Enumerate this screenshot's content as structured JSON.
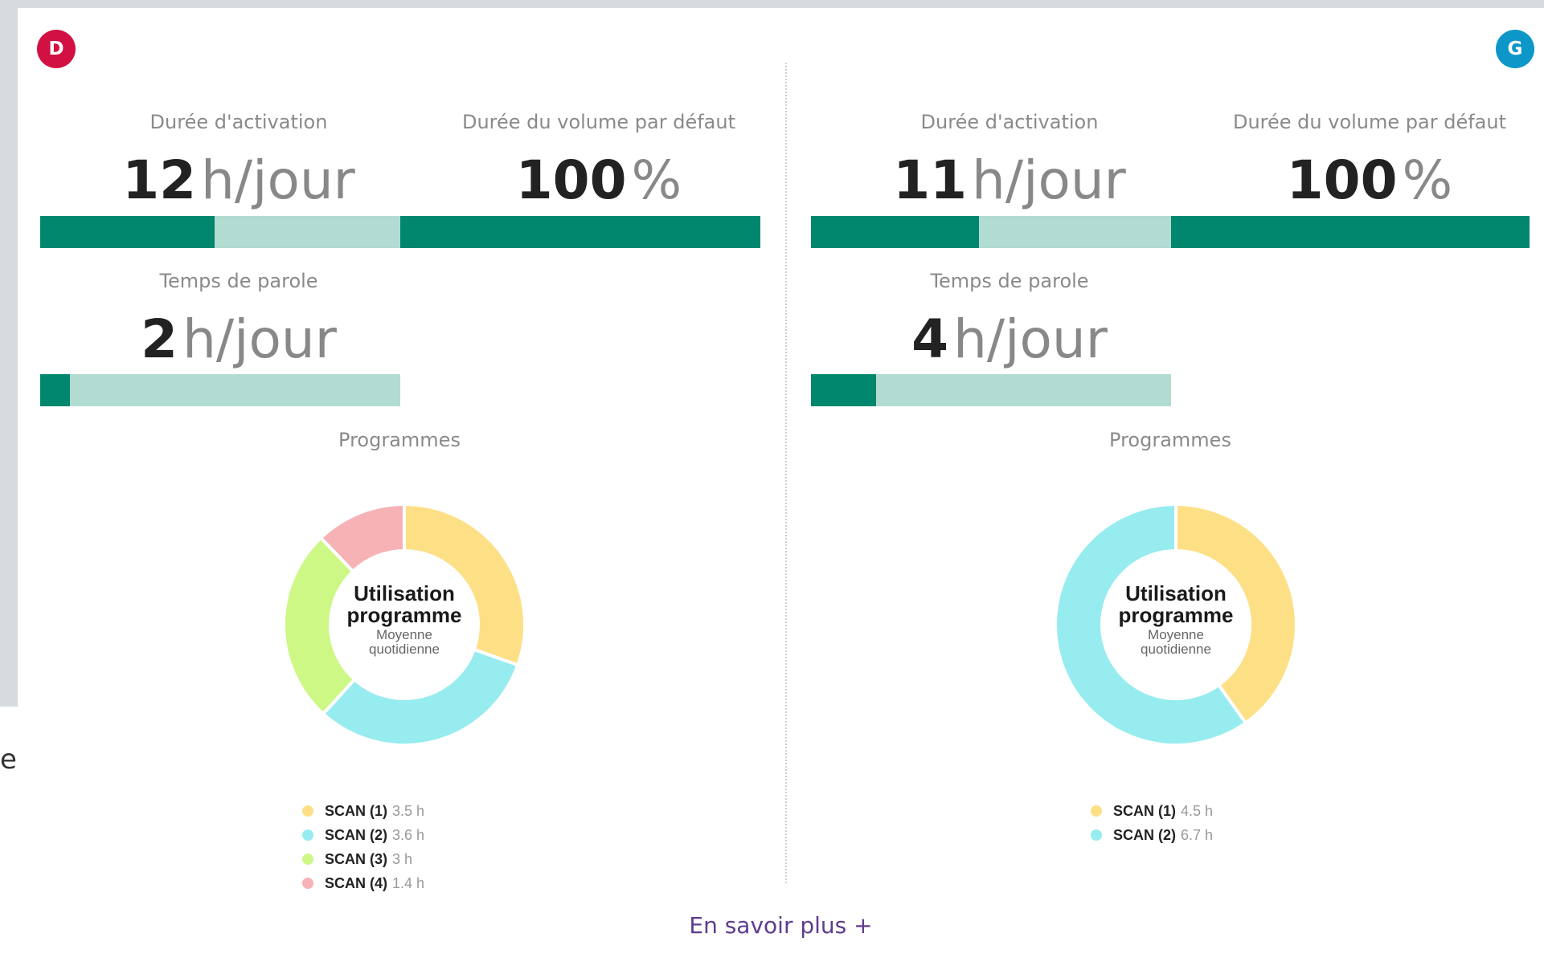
{
  "edge_text": "e",
  "more_link": "En savoir plus +",
  "panels": [
    {
      "badge": "D",
      "badge_color": "#d21042",
      "activation": {
        "label": "Durée d'activation",
        "value": "12",
        "unit": "h/jour",
        "fraction": 0.485
      },
      "volume": {
        "label": "Durée du volume par défaut",
        "value": "100",
        "unit": "%",
        "fraction": 1.0
      },
      "talk": {
        "label": "Temps de parole",
        "value": "2",
        "unit": "h/jour",
        "fraction": 0.083
      },
      "programs_label": "Programmes",
      "donut_title_1": "Utilisation",
      "donut_title_2": "programme",
      "donut_sub_1": "Moyenne",
      "donut_sub_2": "quotidienne",
      "legend": [
        {
          "name": "SCAN (1)",
          "value": "3.5 h"
        },
        {
          "name": "SCAN (2)",
          "value": "3.6 h"
        },
        {
          "name": "SCAN (3)",
          "value": "3 h"
        },
        {
          "name": "SCAN (4)",
          "value": "1.4 h"
        }
      ]
    },
    {
      "badge": "G",
      "badge_color": "#0d96c8",
      "activation": {
        "label": "Durée d'activation",
        "value": "11",
        "unit": "h/jour",
        "fraction": 0.467
      },
      "volume": {
        "label": "Durée du volume par défaut",
        "value": "100",
        "unit": "%",
        "fraction": 1.0
      },
      "talk": {
        "label": "Temps de parole",
        "value": "4",
        "unit": "h/jour",
        "fraction": 0.18
      },
      "programs_label": "Programmes",
      "donut_title_1": "Utilisation",
      "donut_title_2": "programme",
      "donut_sub_1": "Moyenne",
      "donut_sub_2": "quotidienne",
      "legend": [
        {
          "name": "SCAN (1)",
          "value": "4.5 h"
        },
        {
          "name": "SCAN (2)",
          "value": "6.7 h"
        }
      ]
    }
  ],
  "chart_data": [
    {
      "type": "pie",
      "categories": [
        "SCAN (1)",
        "SCAN (2)",
        "SCAN (3)",
        "SCAN (4)"
      ],
      "values": [
        3.5,
        3.6,
        3,
        1.4
      ],
      "colors": [
        "#fddf85",
        "#97ecef",
        "#cdf886",
        "#f7b2b5"
      ]
    },
    {
      "type": "pie",
      "categories": [
        "SCAN (1)",
        "SCAN (2)"
      ],
      "values": [
        4.5,
        6.7
      ],
      "colors": [
        "#fddf85",
        "#97ecef"
      ]
    }
  ]
}
